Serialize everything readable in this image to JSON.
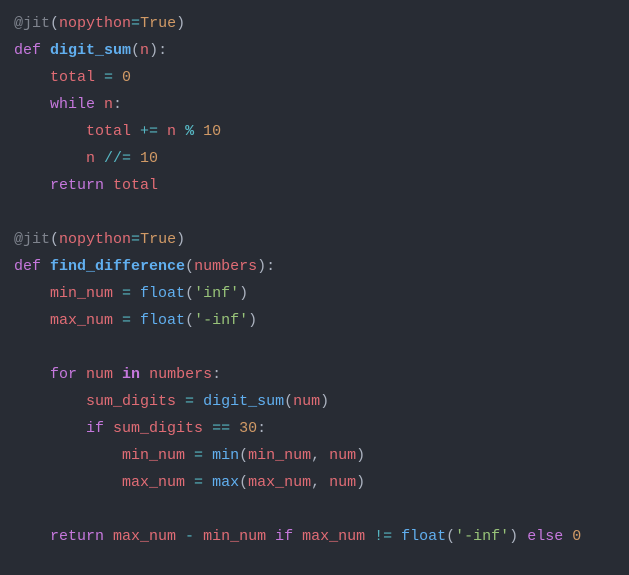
{
  "code": {
    "tokens": [
      [
        {
          "t": "@jit",
          "c": "t-decor"
        },
        {
          "t": "(",
          "c": "t-plain"
        },
        {
          "t": "nopython",
          "c": "t-param"
        },
        {
          "t": "=",
          "c": "t-op"
        },
        {
          "t": "True",
          "c": "t-bool"
        },
        {
          "t": ")",
          "c": "t-plain"
        }
      ],
      [
        {
          "t": "def ",
          "c": "t-keyword"
        },
        {
          "t": "digit_sum",
          "c": "t-func bold"
        },
        {
          "t": "(",
          "c": "t-plain"
        },
        {
          "t": "n",
          "c": "t-param"
        },
        {
          "t": ")",
          "c": "t-plain"
        },
        {
          "t": ":",
          "c": "t-plain"
        }
      ],
      [
        {
          "t": "    ",
          "c": "t-plain"
        },
        {
          "t": "total ",
          "c": "t-param"
        },
        {
          "t": "= ",
          "c": "t-op"
        },
        {
          "t": "0",
          "c": "t-num"
        }
      ],
      [
        {
          "t": "    ",
          "c": "t-plain"
        },
        {
          "t": "while ",
          "c": "t-keyword"
        },
        {
          "t": "n",
          "c": "t-param"
        },
        {
          "t": ":",
          "c": "t-plain"
        }
      ],
      [
        {
          "t": "        ",
          "c": "t-plain"
        },
        {
          "t": "total ",
          "c": "t-param"
        },
        {
          "t": "+= ",
          "c": "t-op"
        },
        {
          "t": "n ",
          "c": "t-param"
        },
        {
          "t": "% ",
          "c": "t-op bold"
        },
        {
          "t": "10",
          "c": "t-num"
        }
      ],
      [
        {
          "t": "        ",
          "c": "t-plain"
        },
        {
          "t": "n ",
          "c": "t-param"
        },
        {
          "t": "//= ",
          "c": "t-op"
        },
        {
          "t": "10",
          "c": "t-num"
        }
      ],
      [
        {
          "t": "    ",
          "c": "t-plain"
        },
        {
          "t": "return ",
          "c": "t-keyword"
        },
        {
          "t": "total",
          "c": "t-param"
        }
      ],
      [],
      [
        {
          "t": "@jit",
          "c": "t-decor"
        },
        {
          "t": "(",
          "c": "t-plain"
        },
        {
          "t": "nopython",
          "c": "t-param"
        },
        {
          "t": "=",
          "c": "t-op"
        },
        {
          "t": "True",
          "c": "t-bool"
        },
        {
          "t": ")",
          "c": "t-plain"
        }
      ],
      [
        {
          "t": "def ",
          "c": "t-keyword"
        },
        {
          "t": "find_difference",
          "c": "t-func bold"
        },
        {
          "t": "(",
          "c": "t-plain"
        },
        {
          "t": "numbers",
          "c": "t-param"
        },
        {
          "t": ")",
          "c": "t-plain"
        },
        {
          "t": ":",
          "c": "t-plain"
        }
      ],
      [
        {
          "t": "    ",
          "c": "t-plain"
        },
        {
          "t": "min_num ",
          "c": "t-param"
        },
        {
          "t": "= ",
          "c": "t-op"
        },
        {
          "t": "float",
          "c": "t-func"
        },
        {
          "t": "(",
          "c": "t-plain"
        },
        {
          "t": "'inf'",
          "c": "t-str"
        },
        {
          "t": ")",
          "c": "t-plain"
        }
      ],
      [
        {
          "t": "    ",
          "c": "t-plain"
        },
        {
          "t": "max_num ",
          "c": "t-param"
        },
        {
          "t": "= ",
          "c": "t-op"
        },
        {
          "t": "float",
          "c": "t-func"
        },
        {
          "t": "(",
          "c": "t-plain"
        },
        {
          "t": "'-inf'",
          "c": "t-str"
        },
        {
          "t": ")",
          "c": "t-plain"
        }
      ],
      [],
      [
        {
          "t": "    ",
          "c": "t-plain"
        },
        {
          "t": "for ",
          "c": "t-keyword"
        },
        {
          "t": "num ",
          "c": "t-param"
        },
        {
          "t": "in ",
          "c": "t-keyword bold"
        },
        {
          "t": "numbers",
          "c": "t-param"
        },
        {
          "t": ":",
          "c": "t-plain"
        }
      ],
      [
        {
          "t": "        ",
          "c": "t-plain"
        },
        {
          "t": "sum_digits ",
          "c": "t-param"
        },
        {
          "t": "= ",
          "c": "t-op"
        },
        {
          "t": "digit_sum",
          "c": "t-func"
        },
        {
          "t": "(",
          "c": "t-plain"
        },
        {
          "t": "num",
          "c": "t-param"
        },
        {
          "t": ")",
          "c": "t-plain"
        }
      ],
      [
        {
          "t": "        ",
          "c": "t-plain"
        },
        {
          "t": "if ",
          "c": "t-keyword"
        },
        {
          "t": "sum_digits ",
          "c": "t-param"
        },
        {
          "t": "== ",
          "c": "t-op"
        },
        {
          "t": "30",
          "c": "t-num"
        },
        {
          "t": ":",
          "c": "t-plain"
        }
      ],
      [
        {
          "t": "            ",
          "c": "t-plain"
        },
        {
          "t": "min_num ",
          "c": "t-param"
        },
        {
          "t": "= ",
          "c": "t-op"
        },
        {
          "t": "min",
          "c": "t-func"
        },
        {
          "t": "(",
          "c": "t-plain"
        },
        {
          "t": "min_num",
          "c": "t-param"
        },
        {
          "t": ", ",
          "c": "t-plain"
        },
        {
          "t": "num",
          "c": "t-param"
        },
        {
          "t": ")",
          "c": "t-plain"
        }
      ],
      [
        {
          "t": "            ",
          "c": "t-plain"
        },
        {
          "t": "max_num ",
          "c": "t-param"
        },
        {
          "t": "= ",
          "c": "t-op"
        },
        {
          "t": "max",
          "c": "t-func"
        },
        {
          "t": "(",
          "c": "t-plain"
        },
        {
          "t": "max_num",
          "c": "t-param"
        },
        {
          "t": ", ",
          "c": "t-plain"
        },
        {
          "t": "num",
          "c": "t-param"
        },
        {
          "t": ")",
          "c": "t-plain"
        }
      ],
      [],
      [
        {
          "t": "    ",
          "c": "t-plain"
        },
        {
          "t": "return ",
          "c": "t-keyword"
        },
        {
          "t": "max_num ",
          "c": "t-param"
        },
        {
          "t": "- ",
          "c": "t-op"
        },
        {
          "t": "min_num ",
          "c": "t-param"
        },
        {
          "t": "if ",
          "c": "t-keyword"
        },
        {
          "t": "max_num ",
          "c": "t-param"
        },
        {
          "t": "!= ",
          "c": "t-op"
        },
        {
          "t": "float",
          "c": "t-func"
        },
        {
          "t": "(",
          "c": "t-plain"
        },
        {
          "t": "'-inf'",
          "c": "t-str"
        },
        {
          "t": ") ",
          "c": "t-plain"
        },
        {
          "t": "else ",
          "c": "t-keyword"
        },
        {
          "t": "0",
          "c": "t-num"
        }
      ]
    ]
  }
}
